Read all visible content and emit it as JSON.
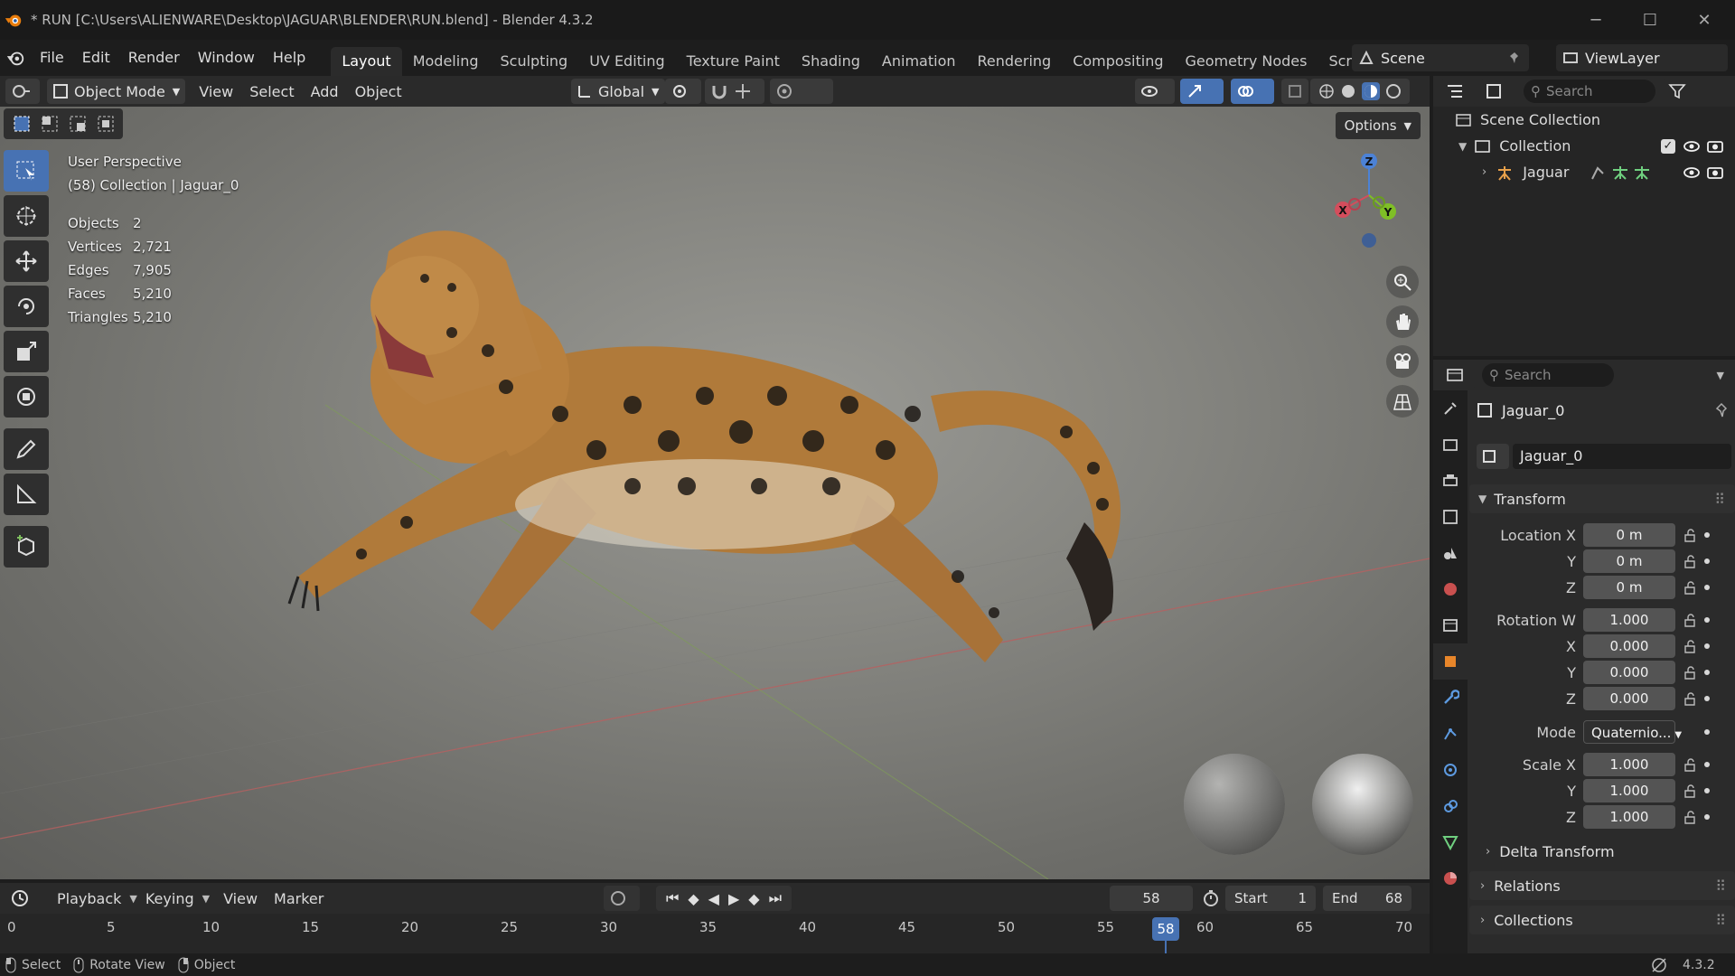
{
  "window": {
    "title": "* RUN [C:\\Users\\ALIENWARE\\Desktop\\JAGUAR\\BLENDER\\RUN.blend] - Blender 4.3.2"
  },
  "menu": [
    "File",
    "Edit",
    "Render",
    "Window",
    "Help"
  ],
  "workspaces": [
    "Layout",
    "Modeling",
    "Sculpting",
    "UV Editing",
    "Texture Paint",
    "Shading",
    "Animation",
    "Rendering",
    "Compositing",
    "Geometry Nodes",
    "Scripting"
  ],
  "workspace_plus": "+",
  "scene": "Scene",
  "view_layer": "ViewLayer",
  "viewport_header": {
    "mode": "Object Mode",
    "menus": [
      "View",
      "Select",
      "Add",
      "Object"
    ],
    "orientation": "Global",
    "options": "Options"
  },
  "viewport": {
    "perspective": "User Perspective",
    "context": "(58) Collection | Jaguar_0",
    "stats": [
      {
        "label": "Objects",
        "value": "2"
      },
      {
        "label": "Vertices",
        "value": "2,721"
      },
      {
        "label": "Edges",
        "value": "7,905"
      },
      {
        "label": "Faces",
        "value": "5,210"
      },
      {
        "label": "Triangles",
        "value": "5,210"
      }
    ],
    "gizmo": {
      "x": "X",
      "y": "Y",
      "z": "Z"
    }
  },
  "timeline": {
    "menus": [
      "Playback",
      "Keying",
      "View",
      "Marker"
    ],
    "current_frame": "58",
    "start_label": "Start",
    "start": "1",
    "end_label": "End",
    "end": "68",
    "ticks": [
      "0",
      "5",
      "10",
      "15",
      "20",
      "25",
      "30",
      "35",
      "40",
      "45",
      "50",
      "55",
      "60",
      "65",
      "70"
    ],
    "playhead": "58"
  },
  "statusbar": {
    "select": "Select",
    "rotate": "Rotate View",
    "object": "Object",
    "version": "4.3.2"
  },
  "outliner": {
    "search_placeholder": "Search",
    "scene_collection": "Scene Collection",
    "collection": "Collection",
    "jaguar": "Jaguar"
  },
  "properties": {
    "search_placeholder": "Search",
    "object_name": "Jaguar_0",
    "data_name": "Jaguar_0",
    "transform": "Transform",
    "location_label": "Location X",
    "location": [
      "0 m",
      "0 m",
      "0 m"
    ],
    "rotation_label": "Rotation W",
    "rotation": [
      "1.000",
      "0.000",
      "0.000",
      "0.000"
    ],
    "mode_label": "Mode",
    "mode": "Quaternio...",
    "scale_label": "Scale X",
    "scale": [
      "1.000",
      "1.000",
      "1.000"
    ],
    "axis_y": "Y",
    "axis_z": "Z",
    "axis_x": "X",
    "delta": "Delta Transform",
    "relations": "Relations",
    "collections": "Collections"
  }
}
